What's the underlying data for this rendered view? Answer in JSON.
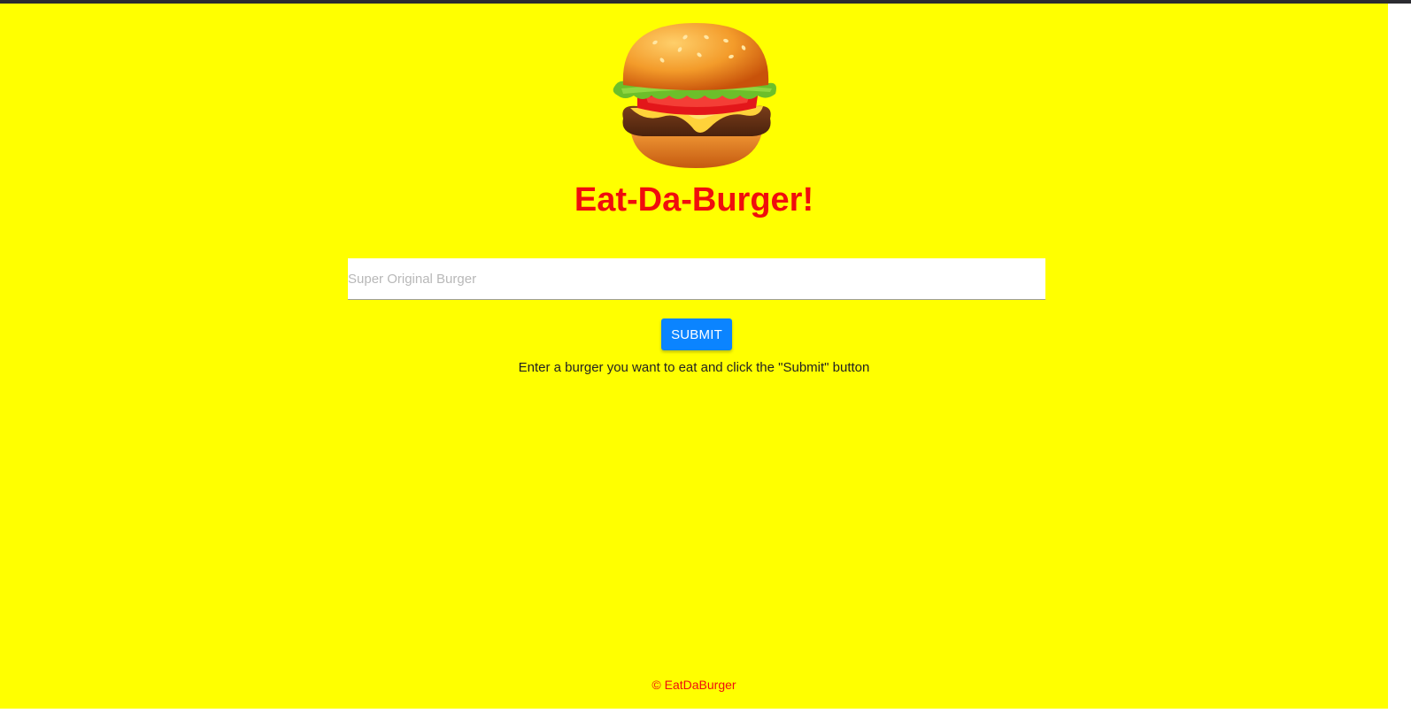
{
  "app": {
    "title": "Eat-Da-Burger!",
    "logo_icon": "burger-icon"
  },
  "form": {
    "placeholder": "Super Original Burger",
    "value": "",
    "submit_label": "SUBMIT",
    "hint": "Enter a burger you want to eat and click the \"Submit\" button"
  },
  "footer": {
    "text": "© EatDaBurger"
  },
  "colors": {
    "background": "#ffff00",
    "title": "#f00d0d",
    "button": "#0b84ff",
    "footer": "#f00d0d"
  }
}
